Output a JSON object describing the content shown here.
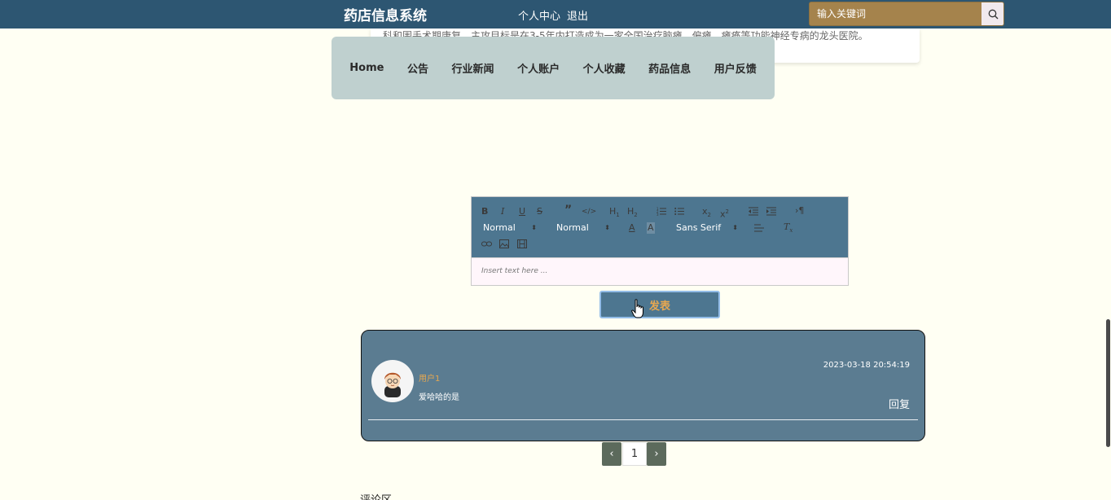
{
  "header": {
    "site_title": "药店信息系统",
    "links": {
      "profile": "个人中心",
      "logout": "退出"
    },
    "search": {
      "placeholder": "输入关键词"
    }
  },
  "background_text": "科和围手术期康复，主攻目标是在3-5年内打造成为一家全国治疗脑瘫、偏瘫、瘫痪等功能神经专病的龙头医院。",
  "nav": {
    "items": [
      "Home",
      "公告",
      "行业新闻",
      "个人账户",
      "个人收藏",
      "药品信息",
      "用户反馈"
    ]
  },
  "editor": {
    "selects": {
      "size": "Normal",
      "header": "Normal",
      "font": "Sans Serif"
    },
    "placeholder": "Insert text here ..."
  },
  "post_button": "发表",
  "comment": {
    "username": "用户1",
    "text": "爱哈哈的是",
    "time": "2023-03-18 20:54:19",
    "reply": "回复"
  },
  "pagination": {
    "prev": "‹",
    "current": "1",
    "next": "›"
  },
  "section_label": "评论区",
  "colors": {
    "header_bg": "#2d5672",
    "nav_bg": "#bfd0cf",
    "toolbar_bg": "#4d7690",
    "comment_bg": "#5b7c91",
    "accent": "#e8a850",
    "page_bg": "#fffff3"
  }
}
